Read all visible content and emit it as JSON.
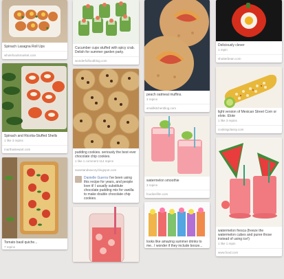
{
  "pins": {
    "p1": {
      "desc": "Spinach Lasagna Roll Ups",
      "meta": "",
      "src": "wholefoodsmarket.com"
    },
    "p2": {
      "desc": "Spinach and Ricotta-Stuffed Shells",
      "meta": "1 like  3 repins",
      "src": "marthastewart.com"
    },
    "p3": {
      "desc": "Tomato basil quiche...",
      "meta": "7 repins",
      "src": ""
    },
    "p4": {
      "desc": "Cucumber cups stuffed with spicy crab. Delish for summer garden party.",
      "meta": "",
      "src": "wonderfulfoodblog.com"
    },
    "p5": {
      "desc": "pudding cookies. seriously the best ever chocolate chip cookies.",
      "meta": "1 like  1 comment  114 repins",
      "src": "sweetandsavory.blogspot.com"
    },
    "p5c": {
      "user": "Danielle Guerra",
      "text": "I've been using this recipe for years, and people love it! I usually substitute chocolate pudding mix for vanilla to make double chocolate chip cookies."
    },
    "p7": {
      "desc": "peach oatmeal muffins.",
      "meta": "3 repins",
      "src": "smallkitchenblog.com"
    },
    "p8": {
      "desc": "watermelon smoothie",
      "meta": "3 repins",
      "src": "foodiesfilm.com"
    },
    "p9": {
      "desc": "looks like amazing summer drinks to me.. I wonder if they include booze...",
      "meta": "",
      "src": ""
    },
    "p10": {
      "desc": "Deliciously clever",
      "meta": "1 repin",
      "src": "shutterbean.com"
    },
    "p11": {
      "desc": "light version of Mexican Street Corn or elote.",
      "meta_link": "Elote",
      "meta": "1 like  3 repins",
      "src": "cookingclassy.com"
    },
    "p12": {
      "desc": "watermelon fresca (freeze the watermelon cubes and puree those instead of using ice!)",
      "meta": "1 like  1 repin",
      "src": "www.food.com"
    }
  }
}
